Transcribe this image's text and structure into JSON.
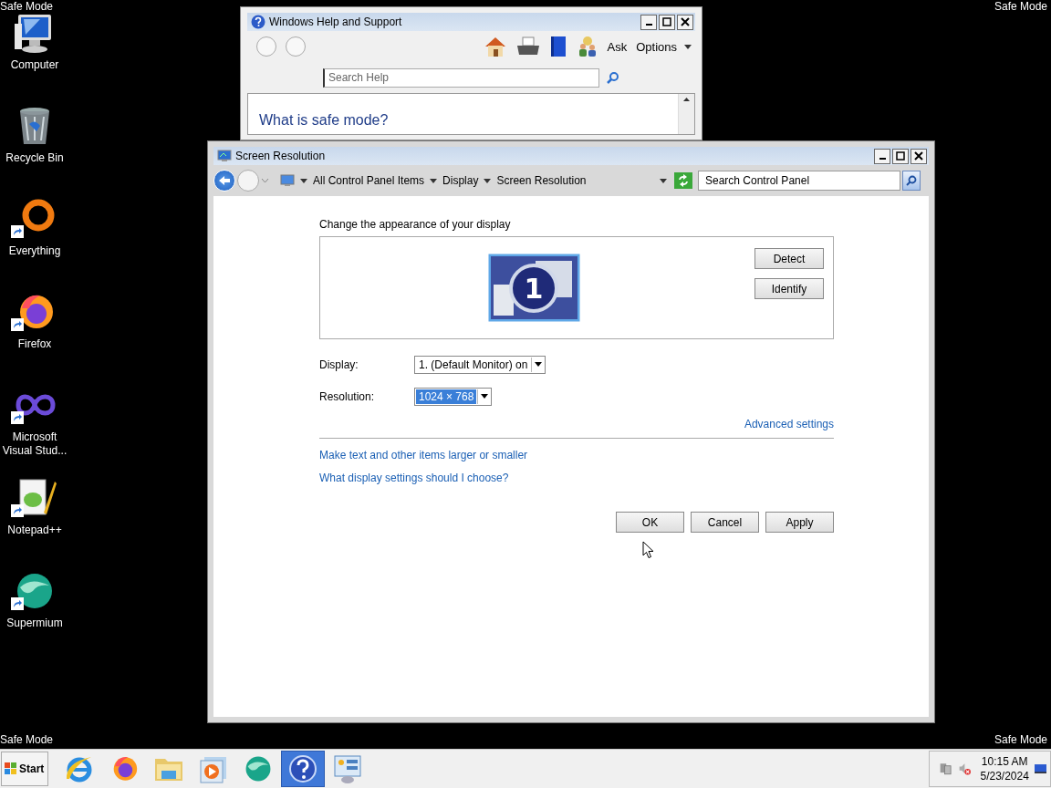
{
  "desktop": {
    "corner_labels": [
      "Safe Mode",
      "Safe Mode",
      "Safe Mode",
      "Safe Mode"
    ],
    "icons": [
      {
        "label": "Computer",
        "kind": "computer",
        "shortcut": false
      },
      {
        "label": "Recycle Bin",
        "kind": "recycle",
        "shortcut": false
      },
      {
        "label": "Everything",
        "kind": "ring",
        "shortcut": true
      },
      {
        "label": "Firefox",
        "kind": "firefox",
        "shortcut": true
      },
      {
        "label": "Microsoft Visual Stud...",
        "kind": "infinity",
        "shortcut": true
      },
      {
        "label": "Notepad++",
        "kind": "notepad",
        "shortcut": true
      },
      {
        "label": "Supermium",
        "kind": "supermium",
        "shortcut": true
      }
    ]
  },
  "help_window": {
    "title": "Windows Help and Support",
    "ask": "Ask",
    "options": "Options",
    "search": {
      "placeholder": "Search Help"
    },
    "heading": "What is safe mode?"
  },
  "main_window": {
    "title": "Screen Resolution",
    "breadcrumb": [
      "All Control Panel Items",
      "Display",
      "Screen Resolution"
    ],
    "search": {
      "placeholder": "Search Control Panel"
    },
    "heading": "Change the appearance of your display",
    "monitor_number": "1",
    "side_buttons": [
      "Detect",
      "Identify"
    ],
    "fields": [
      {
        "label": "Display:",
        "value": "1. (Default Monitor) on",
        "selected": false
      },
      {
        "label": "Resolution:",
        "value": "1024 × 768",
        "selected": true
      }
    ],
    "advanced_link": "Advanced settings",
    "links": [
      "Make text and other items larger or smaller",
      "What display settings should I choose?"
    ],
    "buttons": [
      "OK",
      "Cancel",
      "Apply"
    ]
  },
  "taskbar": {
    "start": "Start",
    "apps": [
      {
        "kind": "ie",
        "selected": false
      },
      {
        "kind": "firefox",
        "selected": false
      },
      {
        "kind": "folder",
        "selected": false
      },
      {
        "kind": "media",
        "selected": false
      },
      {
        "kind": "supermium",
        "selected": false
      },
      {
        "kind": "help",
        "selected": true
      },
      {
        "kind": "control",
        "selected": false
      }
    ],
    "clock": {
      "time": "10:15 AM",
      "date": "5/23/2024"
    }
  }
}
